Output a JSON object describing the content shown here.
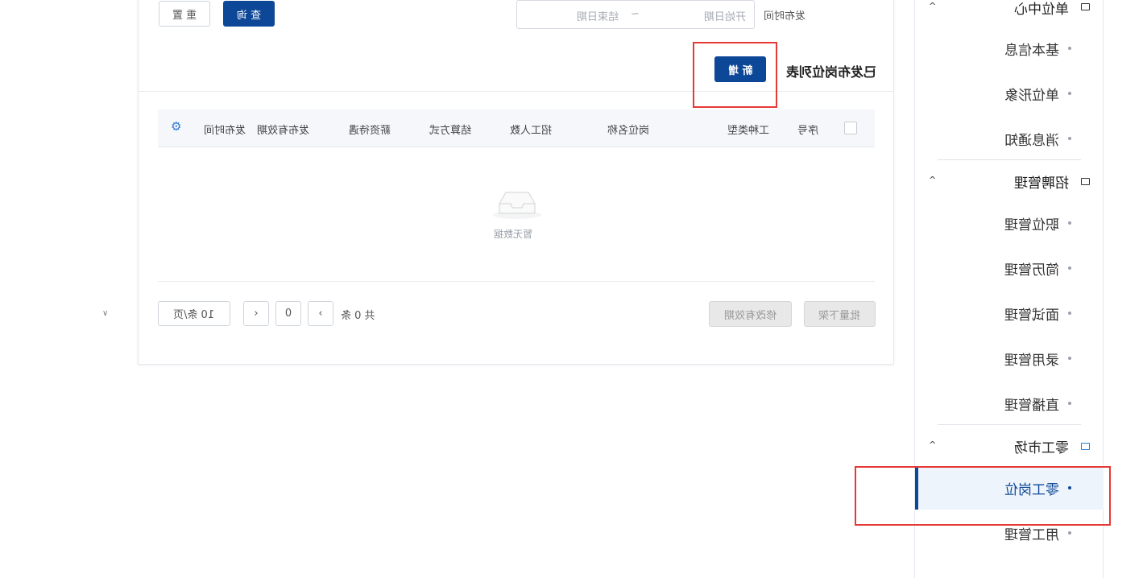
{
  "filters": {
    "reset_label": "重 置",
    "query_label": "查 询",
    "publish_time_label": "发布时间",
    "start_date_placeholder": "开始日期",
    "range_separator": "~",
    "end_date_placeholder": "结束日期"
  },
  "list": {
    "title": "已发布岗位列表",
    "add_button": "新 增"
  },
  "table": {
    "columns": [
      "序号",
      "工种类型",
      "岗位名称",
      "招工人数",
      "结算方式",
      "薪资待遇",
      "发布有效期",
      "发布时间"
    ],
    "empty_text": "暂无数据"
  },
  "pagination": {
    "page_size": "10 条/页",
    "current_page": "0",
    "total": "共 0 条",
    "batch_off_label": "批量下架",
    "modify_validity_label": "修改有效期"
  },
  "sidebar": {
    "groups": [
      {
        "title": "单位中心",
        "items": [
          "基本信息",
          "单位形象",
          "消息通知"
        ]
      },
      {
        "title": "招聘管理",
        "items": [
          "职位管理",
          "简历管理",
          "面试管理",
          "录用管理",
          "直播管理"
        ]
      },
      {
        "title": "零工市场",
        "items": [
          "零工岗位",
          "用工管理"
        ]
      }
    ],
    "active_item": "零工岗位"
  },
  "colors": {
    "primary": "#0d4797",
    "active_bg": "#eef4fb",
    "highlight_red": "#e53935"
  }
}
